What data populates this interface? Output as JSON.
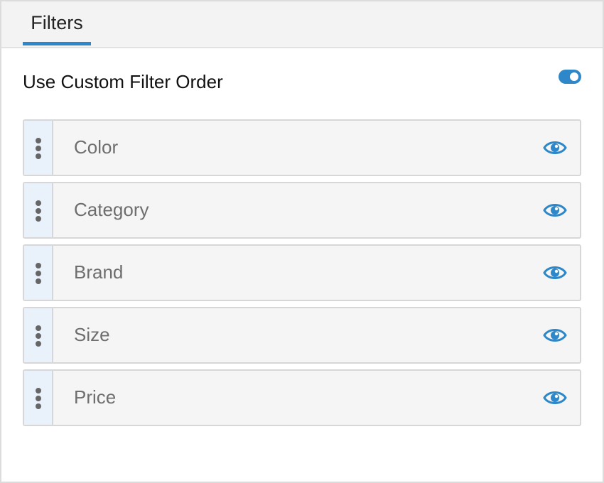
{
  "tabs": [
    {
      "label": "Filters",
      "active": true
    }
  ],
  "custom_order": {
    "label": "Use Custom Filter Order",
    "enabled": true
  },
  "filters": [
    {
      "label": "Color",
      "visible": true
    },
    {
      "label": "Category",
      "visible": true
    },
    {
      "label": "Brand",
      "visible": true
    },
    {
      "label": "Size",
      "visible": true
    },
    {
      "label": "Price",
      "visible": true
    }
  ],
  "colors": {
    "accent": "#2d87c8",
    "handle_bg": "#e9f1fb",
    "item_bg": "#f5f5f5"
  },
  "icons": {
    "drag": "drag-handle-icon",
    "visibility": "eye-icon"
  }
}
